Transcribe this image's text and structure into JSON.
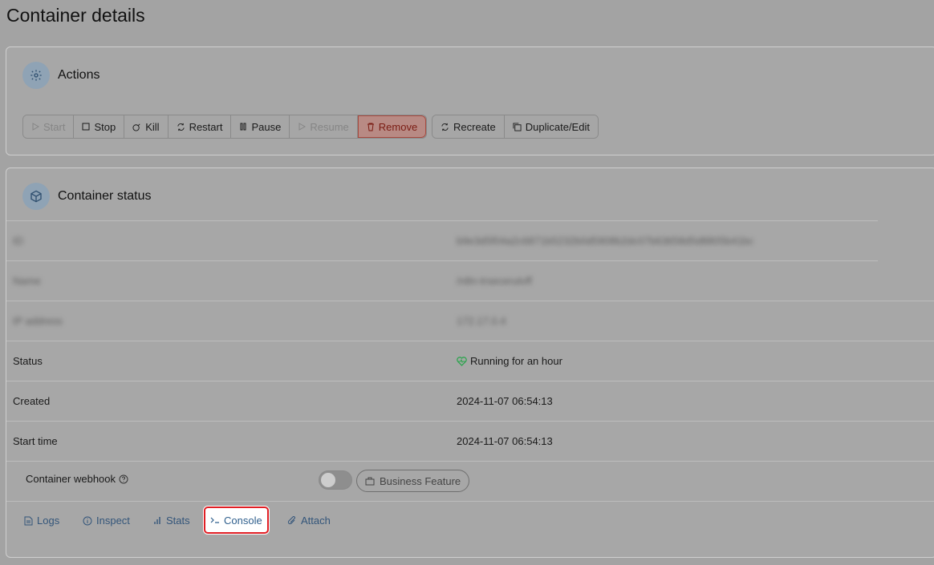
{
  "page": {
    "title": "Container details"
  },
  "actions": {
    "title": "Actions",
    "group1": [
      {
        "label": "Start",
        "icon": "play-icon",
        "disabled": true
      },
      {
        "label": "Stop",
        "icon": "stop-icon",
        "disabled": false
      },
      {
        "label": "Kill",
        "icon": "bomb-icon",
        "disabled": false
      },
      {
        "label": "Restart",
        "icon": "refresh-icon",
        "disabled": false
      },
      {
        "label": "Pause",
        "icon": "pause-icon",
        "disabled": false
      },
      {
        "label": "Resume",
        "icon": "play-icon",
        "disabled": true
      },
      {
        "label": "Remove",
        "icon": "trash-icon",
        "disabled": false
      }
    ],
    "group2": [
      {
        "label": "Recreate",
        "icon": "refresh-icon"
      },
      {
        "label": "Duplicate/Edit",
        "icon": "copy-icon"
      }
    ]
  },
  "status": {
    "title": "Container status",
    "rows": [
      {
        "key": "ID",
        "value": "b9e3d5f04a2c6871b5232b0d5908b2dc07b63658d5d8805b41bc",
        "blurred": true
      },
      {
        "key": "Name",
        "value": "/n8n-trsecerutvff",
        "blurred": true
      },
      {
        "key": "IP address",
        "value": "172.17.0.4",
        "blurred": true
      },
      {
        "key": "Status",
        "value": "Running for an hour",
        "blurred": false
      },
      {
        "key": "Created",
        "value": "2024-11-07 06:54:13",
        "blurred": false
      },
      {
        "key": "Start time",
        "value": "2024-11-07 06:54:13",
        "blurred": false
      }
    ],
    "webhook": {
      "label": "Container webhook",
      "badge": "Business Feature",
      "enabled": false
    }
  },
  "links": [
    {
      "label": "Logs",
      "icon": "file-text-icon",
      "active": false
    },
    {
      "label": "Inspect",
      "icon": "info-icon",
      "active": false
    },
    {
      "label": "Stats",
      "icon": "bar-chart-icon",
      "active": false
    },
    {
      "label": "Console",
      "icon": "terminal-icon",
      "active": true
    },
    {
      "label": "Attach",
      "icon": "paperclip-icon",
      "active": false
    }
  ],
  "colors": {
    "overlay": "#a3a3a3",
    "link": "#2f5f8d",
    "highlight": "#e01e24",
    "running": "#2ea44f"
  }
}
